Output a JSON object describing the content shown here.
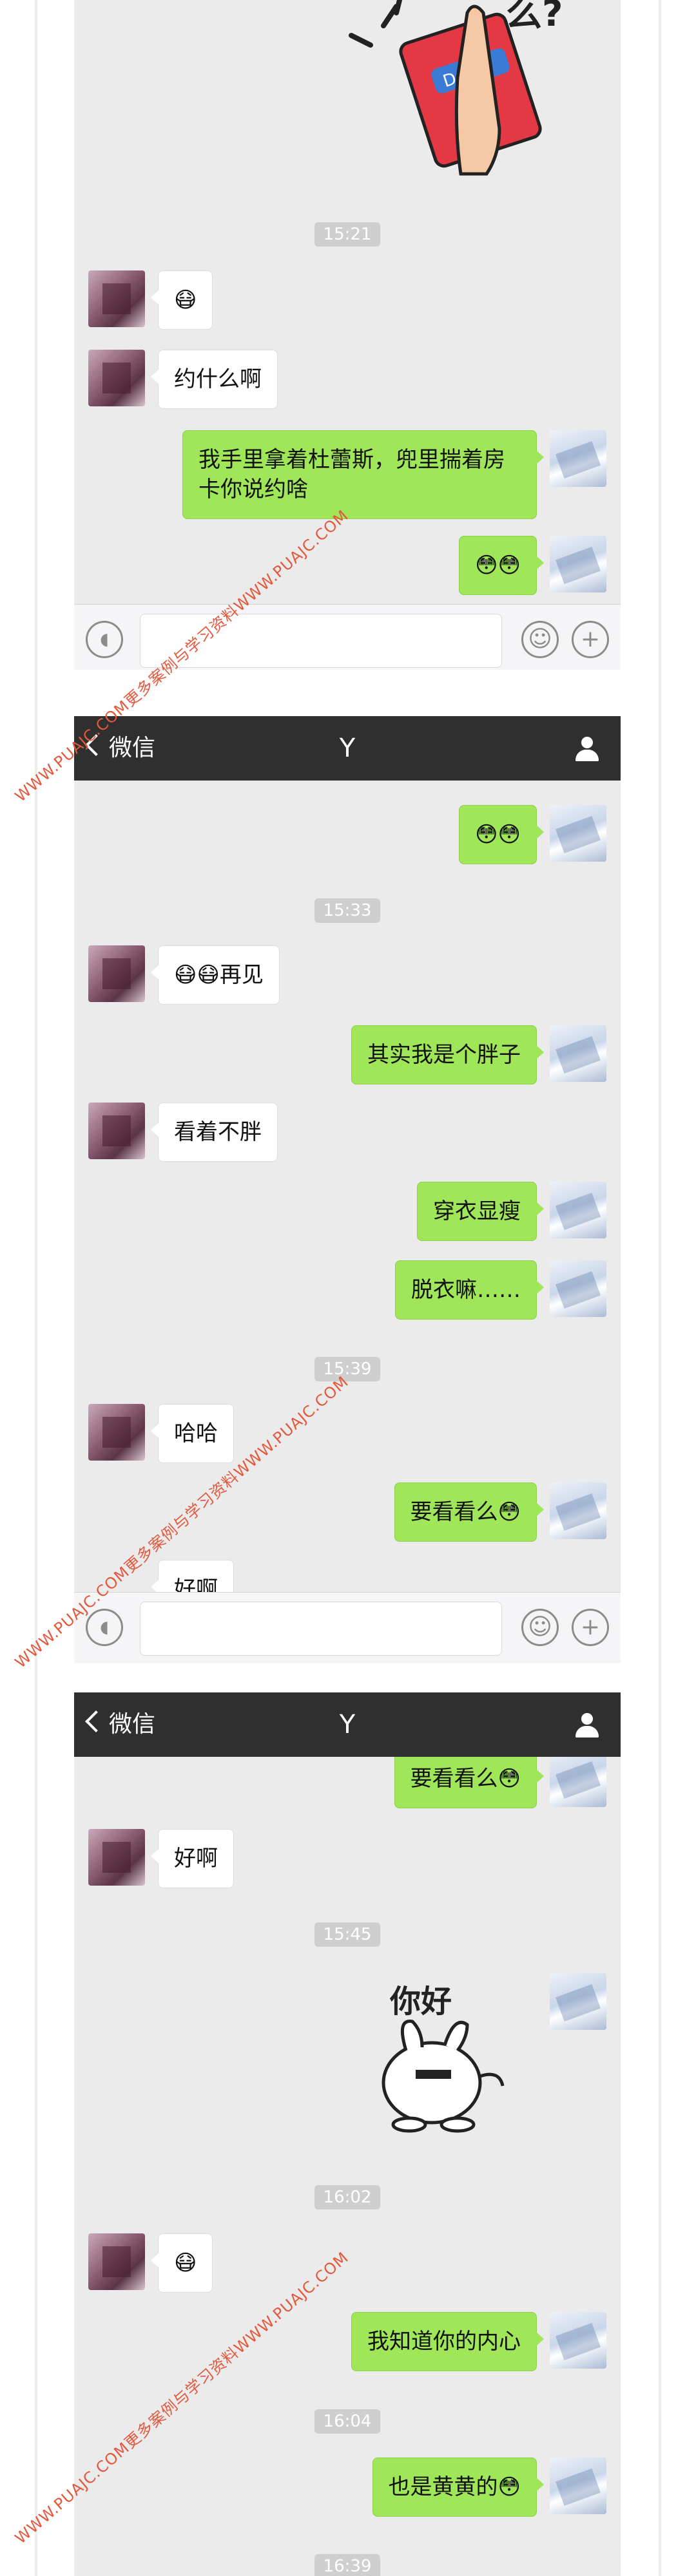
{
  "screens": [
    {
      "navbar": null,
      "times": [
        "15:21"
      ],
      "messages": [
        {
          "side": "in",
          "text": "😷"
        },
        {
          "side": "in",
          "text": "约什么啊"
        },
        {
          "side": "out",
          "text": "我手里拿着杜蕾斯，兜里揣着房卡你说约啥"
        },
        {
          "side": "out",
          "text": "😳😳"
        }
      ]
    },
    {
      "navbar": {
        "back_label": "微信",
        "title": "Y"
      },
      "times": [
        "15:33",
        "15:39"
      ],
      "messages": [
        {
          "side": "out",
          "text": "😳😳"
        },
        {
          "side": "in",
          "text": "😷😷再见"
        },
        {
          "side": "out",
          "text": "其实我是个胖子"
        },
        {
          "side": "in",
          "text": "看着不胖"
        },
        {
          "side": "out",
          "text": "穿衣显瘦"
        },
        {
          "side": "out",
          "text": "脱衣嘛……"
        },
        {
          "side": "in",
          "text": "哈哈"
        },
        {
          "side": "out",
          "text": "要看看么😳"
        },
        {
          "side": "in",
          "text": "好啊"
        }
      ]
    },
    {
      "navbar": {
        "back_label": "微信",
        "title": "Y"
      },
      "times": [
        "15:45",
        "16:02",
        "16:04",
        "16:39"
      ],
      "messages": [
        {
          "side": "out",
          "text": "要看看么😳"
        },
        {
          "side": "in",
          "text": "好啊"
        },
        {
          "side": "in",
          "text": "😷"
        },
        {
          "side": "out",
          "text": "我知道你的内心"
        },
        {
          "side": "out",
          "text": "也是黄黄的😳"
        }
      ]
    }
  ],
  "stickers": {
    "condom_sticker_text": "Durex",
    "condom_sticker_caption": "么?",
    "rabbit_sticker_text": "你好"
  },
  "watermark": "WWW.PUAJC.COM更多案例与学习资料WWW.PUAJC.COM",
  "colors": {
    "navbar": "#2f2f2f",
    "chat_bg": "#ebebeb",
    "out_bubble": "#9fe658",
    "in_bubble": "#ffffff"
  }
}
